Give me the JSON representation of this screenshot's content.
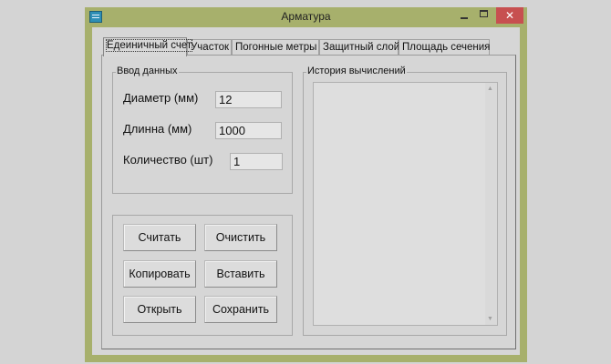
{
  "window": {
    "title": "Арматура",
    "controls": {
      "minimize": "",
      "maximize": "",
      "close": "✕"
    }
  },
  "tabs": [
    {
      "label": "Едеиничный счет",
      "active": true
    },
    {
      "label": "Участок",
      "active": false
    },
    {
      "label": "Погонные метры",
      "active": false
    },
    {
      "label": "Защитный слой",
      "active": false
    },
    {
      "label": "Площадь сечения",
      "active": false
    }
  ],
  "input_group": {
    "title": "Ввод данных",
    "fields": [
      {
        "label": "Диаметр (мм)",
        "value": "12"
      },
      {
        "label": "Длинна   (мм)",
        "value": "1000"
      },
      {
        "label": "Количество (шт)",
        "value": "1"
      }
    ]
  },
  "buttons": {
    "calculate": "Считать",
    "clear": "Очистить",
    "copy": "Копировать",
    "paste": "Вставить",
    "open": "Открыть",
    "save": "Сохранить"
  },
  "history_group": {
    "title": "История вычислений",
    "content": ""
  },
  "icons": {
    "app": "app-icon",
    "scroll_up": "▲",
    "scroll_down": "▼"
  },
  "colors": {
    "frame": "#a7b06c",
    "close": "#c75050",
    "client": "#d6d6d6"
  }
}
